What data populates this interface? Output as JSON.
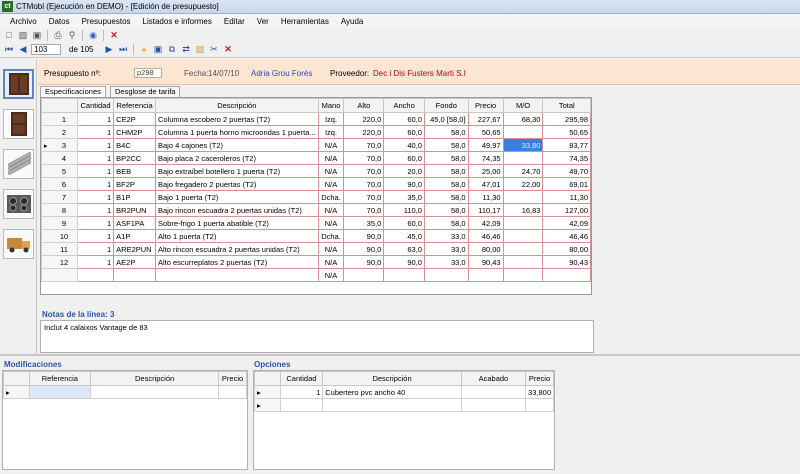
{
  "window": {
    "title": "CTMobl (Ejecución en DEMO) - [Edición de presupuesto]",
    "logo_text": "ct"
  },
  "menu": [
    "Archivo",
    "Datos",
    "Presupuestos",
    "Listados e informes",
    "Editar",
    "Ver",
    "Herramientas",
    "Ayuda"
  ],
  "navigator": {
    "record": "103",
    "of_label": "de 105"
  },
  "header": {
    "budget_label": "Presupuesto nº:",
    "budget_value": "p298",
    "date_label": "Fecha:",
    "date_value": "14/07/10",
    "client_value": "Adria Grou Forés",
    "supplier_label": "Proveedor:",
    "supplier_value": "Dec i Dis Fusters Marti S.I"
  },
  "tabs": [
    "Especificaciones",
    "Desglose de tarifa"
  ],
  "grid": {
    "columns": [
      "Cantidad",
      "Referencia",
      "Descripción",
      "Mano",
      "Alto",
      "Ancho",
      "Fondo",
      "Precio",
      "M/O",
      "Total"
    ],
    "rows": [
      {
        "n": "1",
        "cant": "1",
        "ref": "CE2P",
        "desc": "Columna escobero 2 puertas (T2)",
        "mano": "Izq.",
        "alto": "220,0",
        "ancho": "60,0",
        "fondo": "45,0 [58,0]",
        "precio": "227,67",
        "mo": "68,30",
        "total": "295,98"
      },
      {
        "n": "2",
        "cant": "1",
        "ref": "CHM2P",
        "desc": "Columna 1 puerta horno microondas 1 puerta...",
        "mano": "Izq.",
        "alto": "220,0",
        "ancho": "60,0",
        "fondo": "58,0",
        "precio": "50,65",
        "mo": "",
        "total": "50,65"
      },
      {
        "n": "3",
        "cant": "1",
        "ref": "B4C",
        "desc": "Bajo 4 cajones (T2)",
        "mano": "N/A",
        "alto": "70,0",
        "ancho": "40,0",
        "fondo": "58,0",
        "precio": "49,97",
        "mo": "33,80",
        "total": "83,77"
      },
      {
        "n": "4",
        "cant": "1",
        "ref": "BP2CC",
        "desc": "Bajo placa 2 caceroleros (T2)",
        "mano": "N/A",
        "alto": "70,0",
        "ancho": "60,0",
        "fondo": "58,0",
        "precio": "74,35",
        "mo": "",
        "total": "74,35"
      },
      {
        "n": "5",
        "cant": "1",
        "ref": "BEB",
        "desc": "Bajo extraíbel botellero 1 puerta (T2)",
        "mano": "N/A",
        "alto": "70,0",
        "ancho": "20,0",
        "fondo": "58,0",
        "precio": "25,00",
        "mo": "24,70",
        "total": "49,70"
      },
      {
        "n": "6",
        "cant": "1",
        "ref": "BF2P",
        "desc": "Bajo fregadero 2 puertas (T2)",
        "mano": "N/A",
        "alto": "70,0",
        "ancho": "90,0",
        "fondo": "58,0",
        "precio": "47,01",
        "mo": "22,00",
        "total": "69,01"
      },
      {
        "n": "7",
        "cant": "1",
        "ref": "B1P",
        "desc": "Bajo 1 puerta  (T2)",
        "mano": "Dcha.",
        "alto": "70,0",
        "ancho": "35,0",
        "fondo": "58,0",
        "precio": "11,30",
        "mo": "",
        "total": "11,30"
      },
      {
        "n": "8",
        "cant": "1",
        "ref": "BR2PUN",
        "desc": "Bajo rincon escuadra 2 puertas unidas (T2)",
        "mano": "N/A",
        "alto": "70,0",
        "ancho": "110,0",
        "fondo": "58,0",
        "precio": "110,17",
        "mo": "16,83",
        "total": "127,00"
      },
      {
        "n": "9",
        "cant": "1",
        "ref": "ASF1PA",
        "desc": "Sobre-frigo 1 puerta abatible (T2)",
        "mano": "N/A",
        "alto": "35,0",
        "ancho": "60,0",
        "fondo": "58,0",
        "precio": "42,09",
        "mo": "",
        "total": "42,09"
      },
      {
        "n": "10",
        "cant": "1",
        "ref": "A1P",
        "desc": "Alto 1 puerta (T2)",
        "mano": "Dcha.",
        "alto": "90,0",
        "ancho": "45,0",
        "fondo": "33,0",
        "precio": "46,46",
        "mo": "",
        "total": "46,46"
      },
      {
        "n": "11",
        "cant": "1",
        "ref": "ARE2PUN",
        "desc": "Alto rincon escuadra 2 puertas unidas (T2)",
        "mano": "N/A",
        "alto": "90,0",
        "ancho": "63,0",
        "fondo": "33,0",
        "precio": "80,00",
        "mo": "",
        "total": "80,00"
      },
      {
        "n": "12",
        "cant": "1",
        "ref": "AE2P",
        "desc": "Alto escurreplatos 2 puertas (T2)",
        "mano": "N/A",
        "alto": "90,0",
        "ancho": "90,0",
        "fondo": "33,0",
        "precio": "90,43",
        "mo": "",
        "total": "90,43"
      },
      {
        "n": "",
        "cant": "",
        "ref": "",
        "desc": "",
        "mano": "N/A",
        "alto": "",
        "ancho": "",
        "fondo": "",
        "precio": "",
        "mo": "",
        "total": ""
      }
    ]
  },
  "notes": {
    "label": "Notas de la línea: 3",
    "text": "Inclut 4 calaixos Vantage de 83"
  },
  "modificaciones": {
    "title": "Modificaciones",
    "columns": [
      "Referencia",
      "Descripción",
      "Precio"
    ]
  },
  "opciones": {
    "title": "Opciones",
    "columns": [
      "Cantidad",
      "Descripción",
      "Acabado",
      "Precio"
    ],
    "rows": [
      {
        "cant": "1",
        "desc": "Cubertero pvc ancho 40",
        "acabado": "",
        "precio": "33,800"
      }
    ]
  },
  "colors": {
    "info_bg": "#fce5d2",
    "client": "#3344cc",
    "supplier": "#aa1111",
    "panel_title": "#2c55a4",
    "selection": "#3a7fe0"
  }
}
